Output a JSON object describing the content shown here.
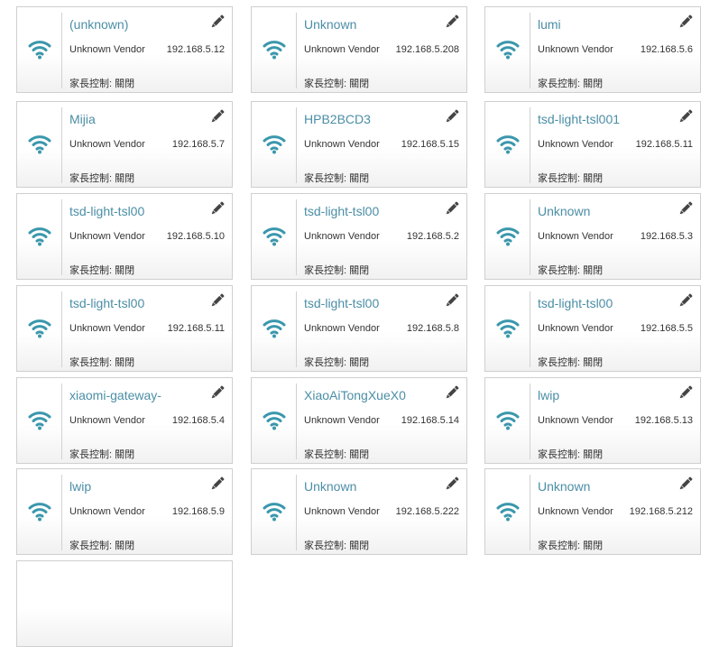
{
  "parental_label": "家長控制:",
  "devices": [
    {
      "name": "(unknown)",
      "vendor": "Unknown Vendor",
      "ip": "192.168.5.12",
      "parental": "關閉",
      "icon": "wifi-icon"
    },
    {
      "name": "Unknown",
      "vendor": "Unknown Vendor",
      "ip": "192.168.5.208",
      "parental": "關閉",
      "icon": "wifi-icon"
    },
    {
      "name": "lumi",
      "vendor": "Unknown Vendor",
      "ip": "192.168.5.6",
      "parental": "關閉",
      "icon": "wifi-icon"
    },
    {
      "name": "Mijia",
      "vendor": "Unknown Vendor",
      "ip": "192.168.5.7",
      "parental": "關閉",
      "icon": "wifi-icon"
    },
    {
      "name": "HPB2BCD3",
      "vendor": "Unknown Vendor",
      "ip": "192.168.5.15",
      "parental": "關閉",
      "icon": "wifi-icon"
    },
    {
      "name": "tsd-light-tsl001",
      "vendor": "Unknown Vendor",
      "ip": "192.168.5.11",
      "parental": "關閉",
      "icon": "wifi-icon"
    },
    {
      "name": "tsd-light-tsl00",
      "vendor": "Unknown Vendor",
      "ip": "192.168.5.10",
      "parental": "關閉",
      "icon": "wifi-icon"
    },
    {
      "name": "tsd-light-tsl00",
      "vendor": "Unknown Vendor",
      "ip": "192.168.5.2",
      "parental": "關閉",
      "icon": "wifi-icon"
    },
    {
      "name": "Unknown",
      "vendor": "Unknown Vendor",
      "ip": "192.168.5.3",
      "parental": "關閉",
      "icon": "wifi-icon"
    },
    {
      "name": "tsd-light-tsl00",
      "vendor": "Unknown Vendor",
      "ip": "192.168.5.11",
      "parental": "關閉",
      "icon": "wifi-icon"
    },
    {
      "name": "tsd-light-tsl00",
      "vendor": "Unknown Vendor",
      "ip": "192.168.5.8",
      "parental": "關閉",
      "icon": "wifi-icon"
    },
    {
      "name": "tsd-light-tsl00",
      "vendor": "Unknown Vendor",
      "ip": "192.168.5.5",
      "parental": "關閉",
      "icon": "wifi-icon"
    },
    {
      "name": "xiaomi-gateway-",
      "vendor": "Unknown Vendor",
      "ip": "192.168.5.4",
      "parental": "關閉",
      "icon": "wifi-icon"
    },
    {
      "name": "XiaoAiTongXueX0",
      "vendor": "Unknown Vendor",
      "ip": "192.168.5.14",
      "parental": "關閉",
      "icon": "wifi-icon"
    },
    {
      "name": "lwip",
      "vendor": "Unknown Vendor",
      "ip": "192.168.5.13",
      "parental": "關閉",
      "icon": "wifi-icon"
    },
    {
      "name": "lwip",
      "vendor": "Unknown Vendor",
      "ip": "192.168.5.9",
      "parental": "關閉",
      "icon": "wifi-icon"
    },
    {
      "name": "Unknown",
      "vendor": "Unknown Vendor",
      "ip": "192.168.5.222",
      "parental": "關閉",
      "icon": "wifi-icon"
    },
    {
      "name": "Unknown",
      "vendor": "Unknown Vendor",
      "ip": "192.168.5.212",
      "parental": "關閉",
      "icon": "wifi-icon"
    }
  ],
  "colors": {
    "accent": "#4b8ea6",
    "wifi": "#3a97ac",
    "border": "#cfcfcf",
    "text": "#333333"
  }
}
